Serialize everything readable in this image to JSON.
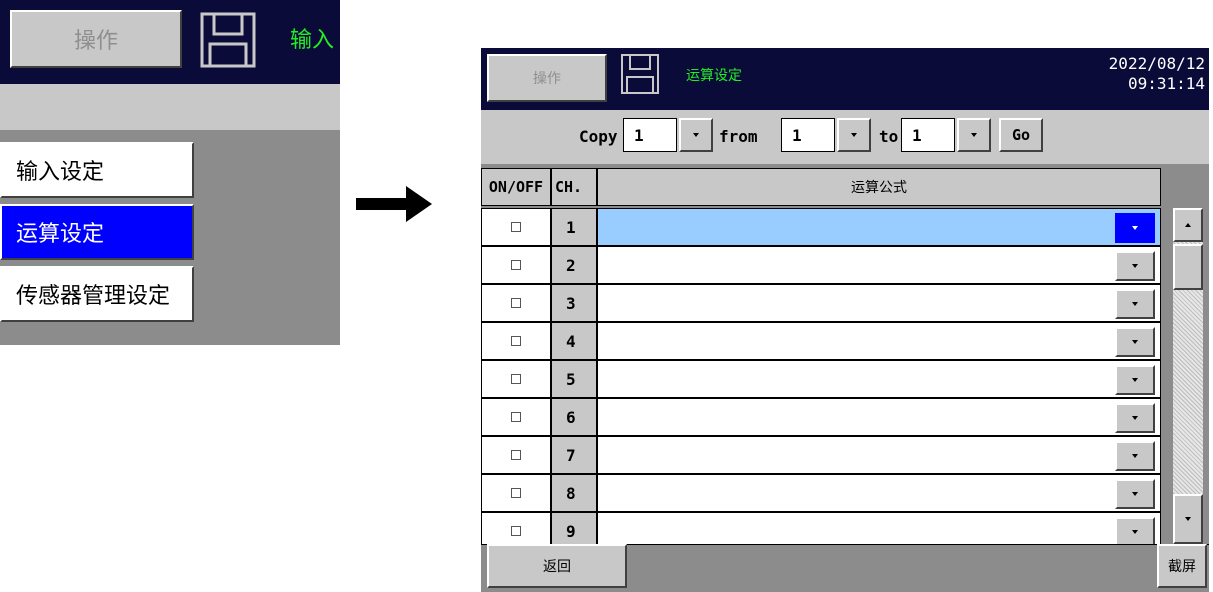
{
  "zoom": {
    "operate_label": "操作",
    "title_partial": "输入",
    "menu": [
      "输入设定",
      "运算设定",
      "传感器管理设定"
    ],
    "selected_index": 1
  },
  "header": {
    "operate_label": "操作",
    "title": "运算设定",
    "date": "2022/08/12",
    "time": "09:31:14",
    "title_color": "#22ee22"
  },
  "copy_bar": {
    "copy_label": "Copy",
    "copy_value": "1",
    "from_label": "from",
    "from_value": "1",
    "to_label": "to",
    "to_value": "1",
    "go_label": "Go"
  },
  "table": {
    "headers": {
      "onoff": "ON/OFF",
      "ch": "CH.",
      "formula": "运算公式"
    },
    "rows": [
      {
        "ch": "1",
        "selected": true
      },
      {
        "ch": "2"
      },
      {
        "ch": "3"
      },
      {
        "ch": "4"
      },
      {
        "ch": "5"
      },
      {
        "ch": "6"
      },
      {
        "ch": "7"
      },
      {
        "ch": "8"
      },
      {
        "ch": "9"
      }
    ]
  },
  "footer": {
    "back_label": "返回",
    "screenshot_label": "截屏"
  },
  "colors": {
    "header_bg": "#0b0b3a",
    "selected_bg": "#0000ff",
    "selected_row": "#99ccff",
    "panel": "#8c8c8c"
  }
}
